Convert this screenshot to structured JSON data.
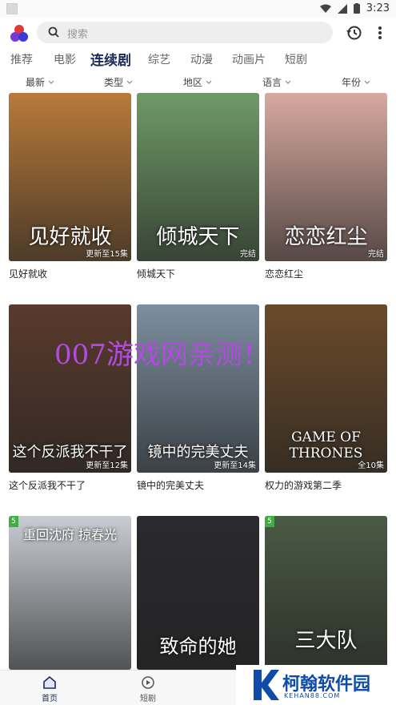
{
  "status_bar": {
    "time": "3:23"
  },
  "search": {
    "placeholder": "搜索"
  },
  "tabs": [
    {
      "label": "推荐"
    },
    {
      "label": "电影"
    },
    {
      "label": "连续剧"
    },
    {
      "label": "综艺"
    },
    {
      "label": "动漫"
    },
    {
      "label": "动画片"
    },
    {
      "label": "短剧"
    }
  ],
  "active_tab": "连续剧",
  "filters": [
    {
      "label": "最新"
    },
    {
      "label": "类型"
    },
    {
      "label": "地区"
    },
    {
      "label": "语言"
    },
    {
      "label": "年份"
    }
  ],
  "cards": [
    {
      "title": "见好就收",
      "badge": "更新至15集",
      "poster_text": "见好就收",
      "color": "#b87a3a"
    },
    {
      "title": "倾城天下",
      "badge": "完结",
      "poster_text": "倾城天下",
      "color": "#6f9a67"
    },
    {
      "title": "恋恋红尘",
      "badge": "完结",
      "poster_text": "恋恋红尘",
      "color": "#d8a9a0"
    },
    {
      "title": "这个反派我不干了",
      "badge": "更新至12集",
      "poster_text": "这个反派我不干了",
      "color": "#5a3a2c"
    },
    {
      "title": "镜中的完美丈夫",
      "badge": "更新至14集",
      "poster_text": "镜中的完美丈夫",
      "color": "#7c8fa0"
    },
    {
      "title": "权力的游戏第二季",
      "badge": "全10集",
      "poster_text": "GAME OF THRONES",
      "color": "#6b4a2a"
    },
    {
      "title": "",
      "badge": "",
      "poster_text": "重回沈府 掠春光",
      "corner": "5",
      "color": "#c9ccd3"
    },
    {
      "title": "",
      "badge": "",
      "poster_text": "致命的她",
      "color": "#2a2a2e"
    },
    {
      "title": "",
      "badge": "",
      "poster_text": "三大队",
      "corner": "5",
      "color": "#4b5a44"
    }
  ],
  "watermark_text": "007游戏网亲测！",
  "bottom_nav": [
    {
      "label": "首页"
    },
    {
      "label": "短剧"
    }
  ],
  "brand": {
    "name": "柯翰软件园",
    "url": "KEHAN88.COM"
  }
}
